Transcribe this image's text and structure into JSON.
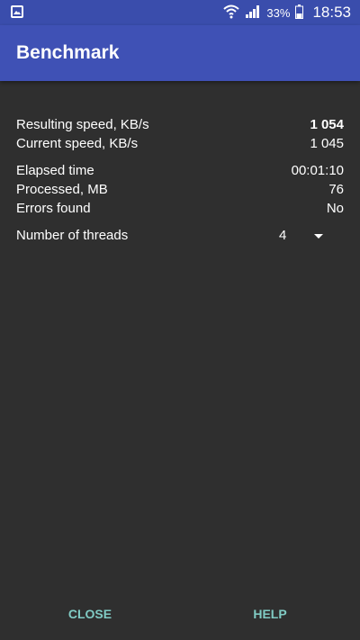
{
  "status_bar": {
    "battery_percent": "33%",
    "time": "18:53",
    "icons": [
      "gallery-icon",
      "wifi-icon",
      "signal-icon",
      "battery-icon"
    ]
  },
  "app_bar": {
    "title": "Benchmark",
    "color": "#3f51b5"
  },
  "stats": {
    "resulting_speed_label": "Resulting speed, KB/s",
    "resulting_speed_value": "1 054",
    "current_speed_label": "Current speed, KB/s",
    "current_speed_value": "1 045",
    "elapsed_time_label": "Elapsed time",
    "elapsed_time_value": "00:01:10",
    "processed_label": "Processed, MB",
    "processed_value": "76",
    "errors_label": "Errors found",
    "errors_value": "No"
  },
  "threads": {
    "label": "Number of threads",
    "selected": "4"
  },
  "buttons": {
    "close": "CLOSE",
    "help": "HELP",
    "accent_color": "#80cbc4"
  }
}
